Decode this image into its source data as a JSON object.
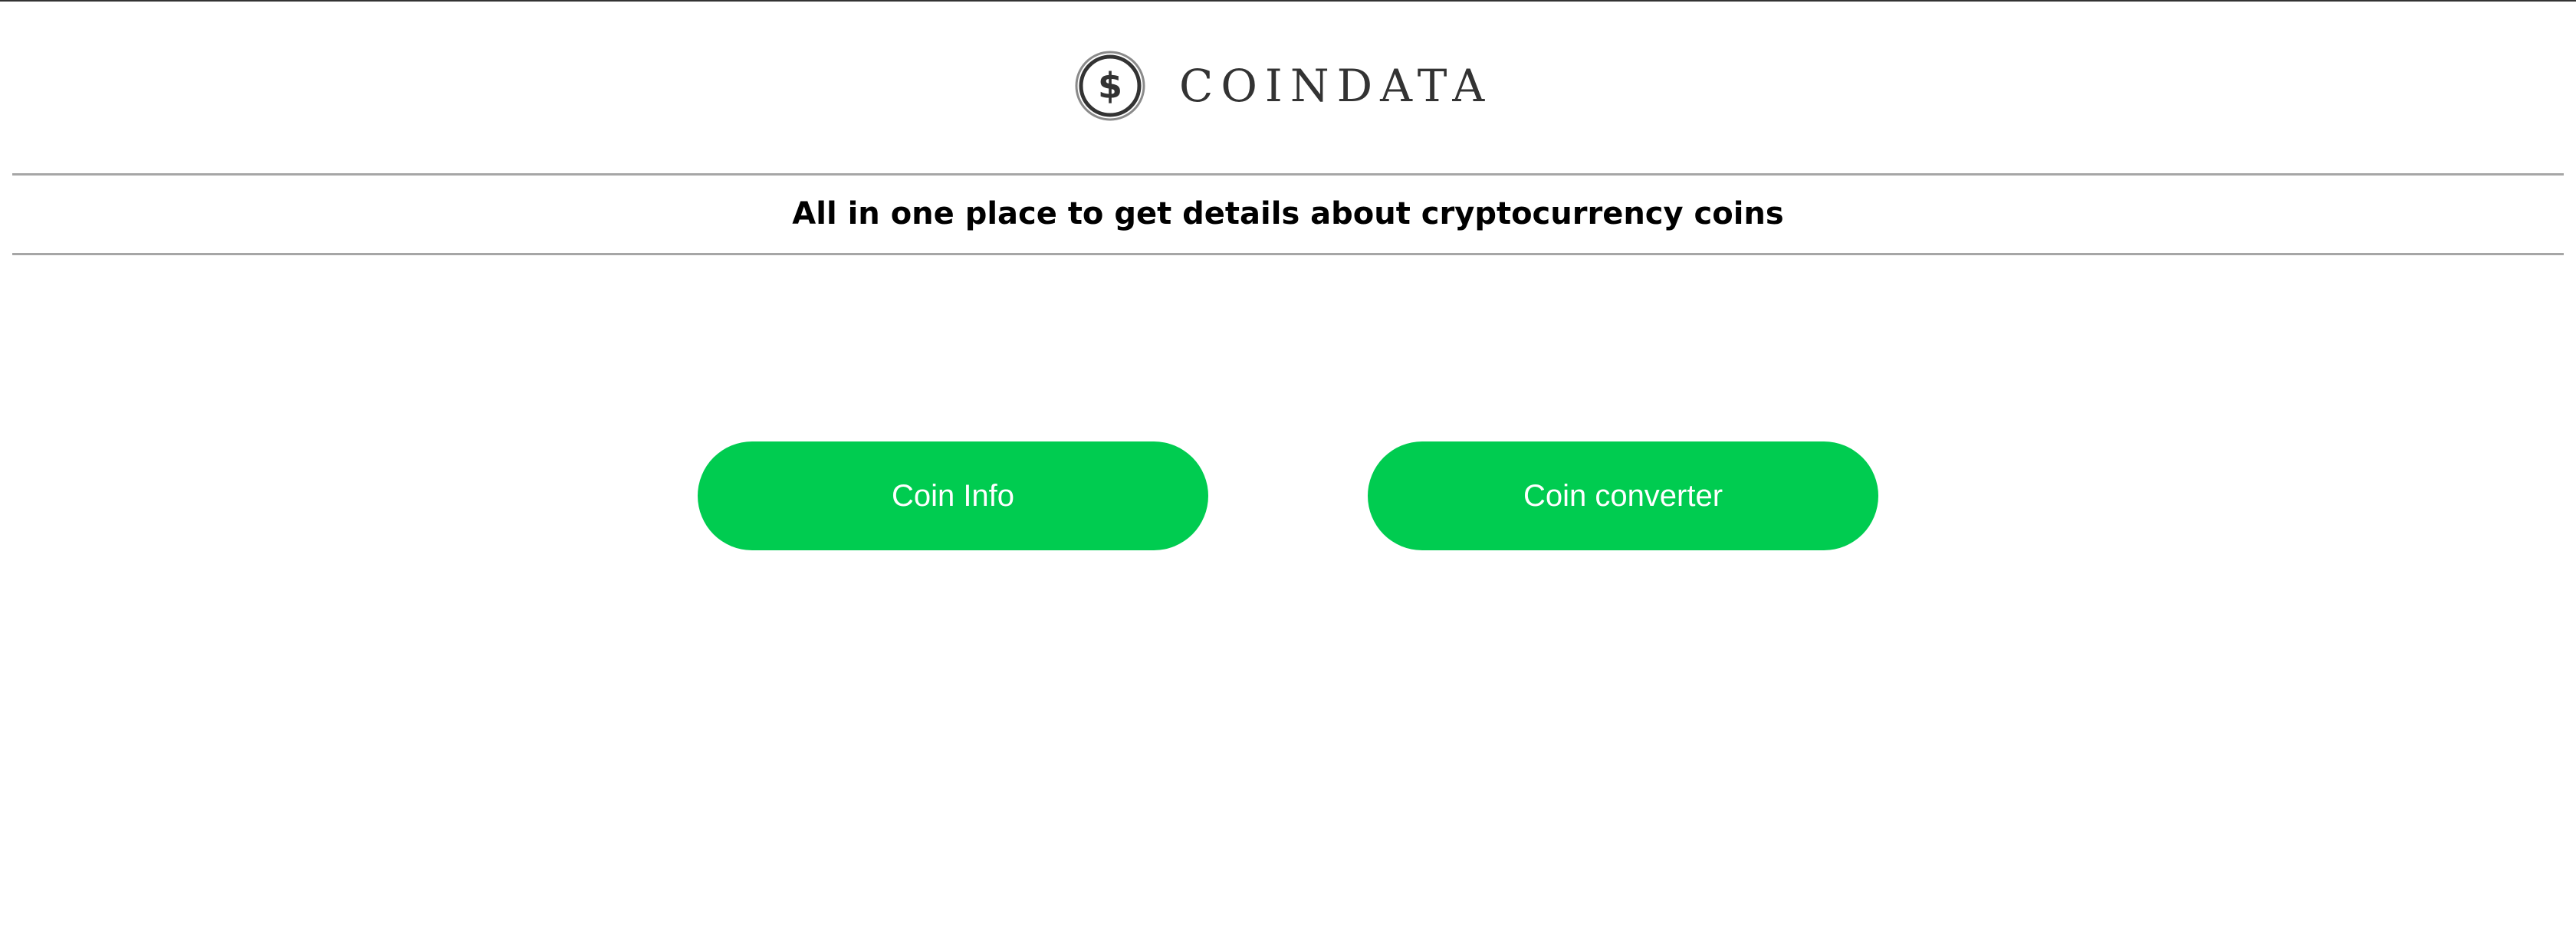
{
  "brand": {
    "name": "COINDATA",
    "logo_icon": "dollar-coin-icon",
    "logo_symbol": "$",
    "text_color": "#333333"
  },
  "tagline": "All in one place to get details about cryptocurrency coins",
  "actions": {
    "coin_info_label": "Coin Info",
    "coin_converter_label": "Coin converter",
    "button_color": "#00cc50"
  },
  "colors": {
    "background": "#ffffff",
    "divider": "#a6a6a6",
    "button_text": "#ffffff"
  }
}
